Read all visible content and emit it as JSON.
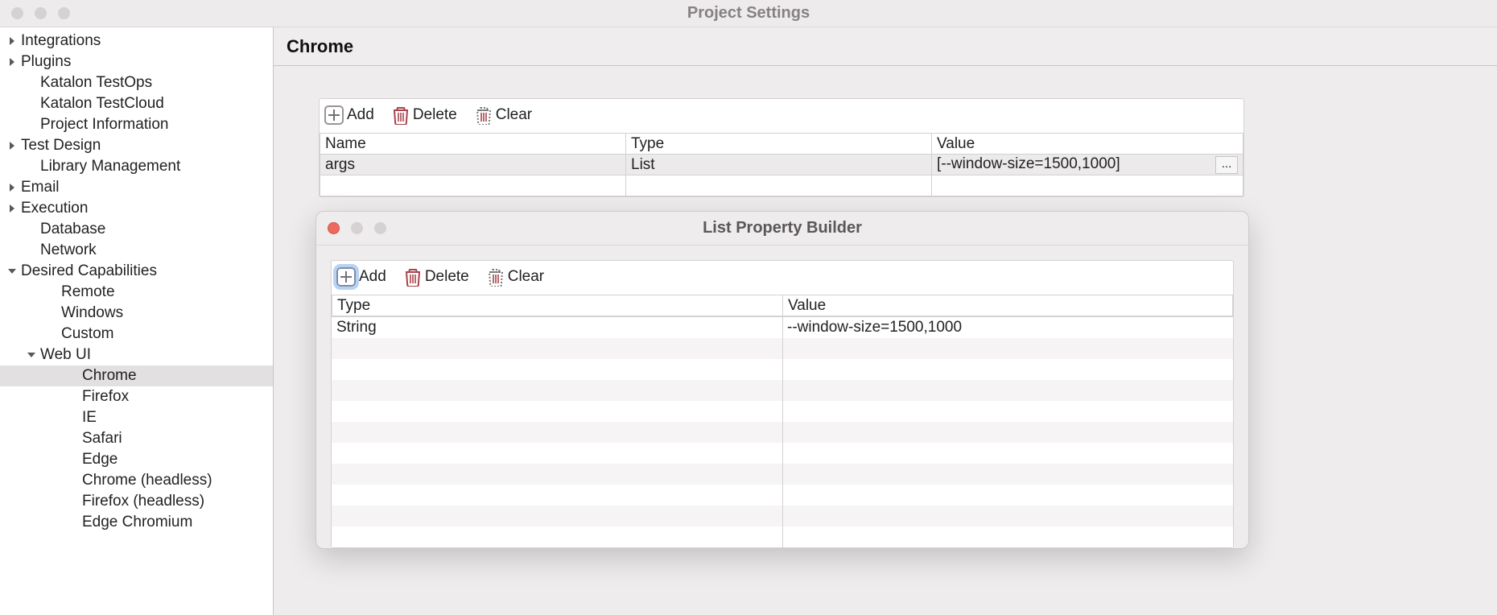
{
  "window": {
    "title": "Project Settings"
  },
  "sidebar": {
    "items": [
      {
        "label": "Integrations",
        "arrow": "right",
        "indent": 0
      },
      {
        "label": "Plugins",
        "arrow": "right",
        "indent": 0
      },
      {
        "label": "Katalon TestOps",
        "arrow": "",
        "indent": 1
      },
      {
        "label": "Katalon TestCloud",
        "arrow": "",
        "indent": 1
      },
      {
        "label": "Project Information",
        "arrow": "",
        "indent": 1
      },
      {
        "label": "Test Design",
        "arrow": "right",
        "indent": 0
      },
      {
        "label": "Library Management",
        "arrow": "",
        "indent": 1
      },
      {
        "label": "Email",
        "arrow": "right",
        "indent": 0
      },
      {
        "label": "Execution",
        "arrow": "right",
        "indent": 0
      },
      {
        "label": "Database",
        "arrow": "",
        "indent": 1
      },
      {
        "label": "Network",
        "arrow": "",
        "indent": 1
      },
      {
        "label": "Desired Capabilities",
        "arrow": "down",
        "indent": 0
      },
      {
        "label": "Remote",
        "arrow": "",
        "indent": 2
      },
      {
        "label": "Windows",
        "arrow": "",
        "indent": 2
      },
      {
        "label": "Custom",
        "arrow": "",
        "indent": 2
      },
      {
        "label": "Web UI",
        "arrow": "down",
        "indent": 1
      },
      {
        "label": "Chrome",
        "arrow": "",
        "indent": 3,
        "selected": true
      },
      {
        "label": "Firefox",
        "arrow": "",
        "indent": 3
      },
      {
        "label": "IE",
        "arrow": "",
        "indent": 3
      },
      {
        "label": "Safari",
        "arrow": "",
        "indent": 3
      },
      {
        "label": "Edge",
        "arrow": "",
        "indent": 3
      },
      {
        "label": "Chrome (headless)",
        "arrow": "",
        "indent": 3
      },
      {
        "label": "Firefox (headless)",
        "arrow": "",
        "indent": 3
      },
      {
        "label": "Edge Chromium",
        "arrow": "",
        "indent": 3
      }
    ]
  },
  "panel": {
    "title": "Chrome",
    "toolbar": {
      "add": "Add",
      "delete": "Delete",
      "clear": "Clear"
    },
    "columns": {
      "name": "Name",
      "type": "Type",
      "value": "Value"
    },
    "rows": [
      {
        "name": "args",
        "type": "List",
        "value": "[--window-size=1500,1000]"
      }
    ],
    "ellipsis": "..."
  },
  "modal": {
    "title": "List Property Builder",
    "toolbar": {
      "add": "Add",
      "delete": "Delete",
      "clear": "Clear"
    },
    "columns": {
      "type": "Type",
      "value": "Value"
    },
    "rows": [
      {
        "type": "String",
        "value": "--window-size=1500,1000"
      }
    ]
  }
}
